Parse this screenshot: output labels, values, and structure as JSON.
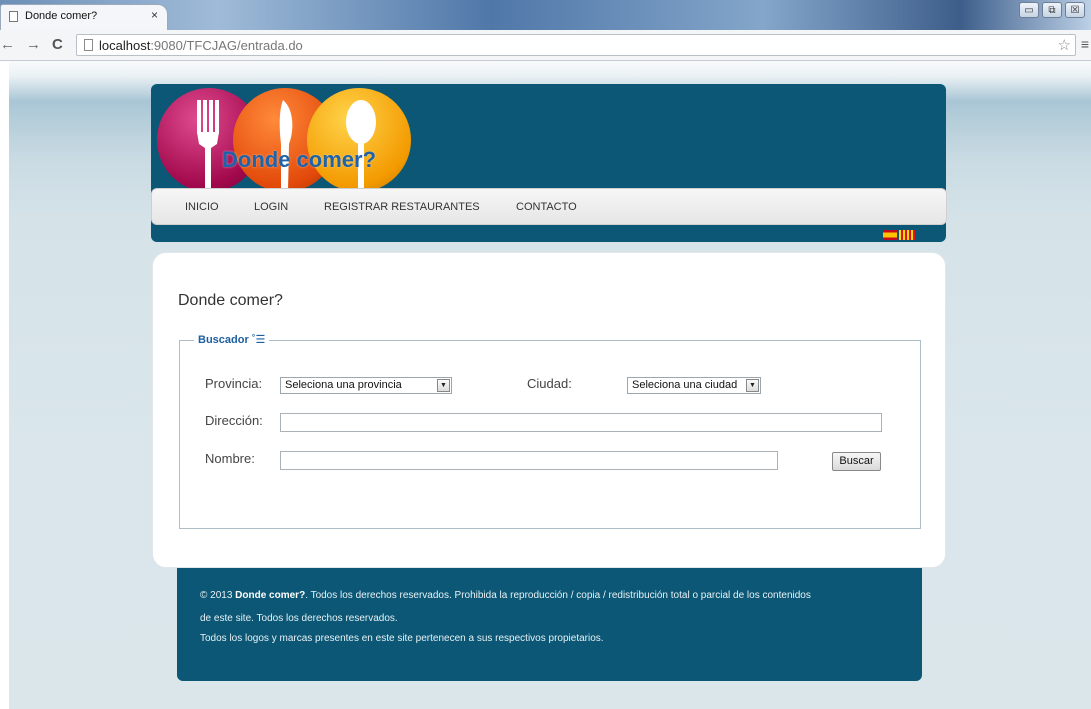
{
  "browser": {
    "tab_title": "Donde comer?",
    "tab_close": "×",
    "url_host": "localhost",
    "url_path": ":9080/TFCJAG/entrada.do",
    "window_controls": [
      "▭",
      "⧉",
      "☒"
    ]
  },
  "header": {
    "site_title": "Donde comer?",
    "nav_items": [
      "INICIO",
      "LOGIN",
      "REGISTRAR RESTAURANTES",
      "CONTACTO"
    ]
  },
  "main": {
    "page_title": "Donde comer?",
    "search": {
      "legend": "Buscador",
      "provincia_label": "Provincia:",
      "provincia_value": "Seleciona una provincia",
      "ciudad_label": "Ciudad:",
      "ciudad_value": "Seleciona una ciudad",
      "direccion_label": "Dirección:",
      "direccion_value": "",
      "nombre_label": "Nombre:",
      "nombre_value": "",
      "buscar_label": "Buscar"
    }
  },
  "footer": {
    "line1_prefix": "© 2013 ",
    "line1_brand": "Donde comer?",
    "line1_text": ". Todos los derechos reservados. Prohibida la reproducción / copia / redistribución total o parcial de los contenidos",
    "line2": "de este site. Todos los derechos reservados.",
    "line3": "Todos los logos y marcas presentes en este site pertenecen a sus respectivos propietarios."
  },
  "colors": {
    "header_bg": "#0b5775",
    "title_blue": "#1f63a8",
    "legend_blue": "#1c5fa0"
  },
  "icons": [
    "page-icon",
    "back-arrow-icon",
    "forward-arrow-icon",
    "reload-icon",
    "bookmark-star-icon",
    "menu-icon",
    "flag-spain-icon",
    "flag-catalonia-icon",
    "fork-icon",
    "knife-icon",
    "spoon-icon",
    "collapse-toggle-icon"
  ]
}
